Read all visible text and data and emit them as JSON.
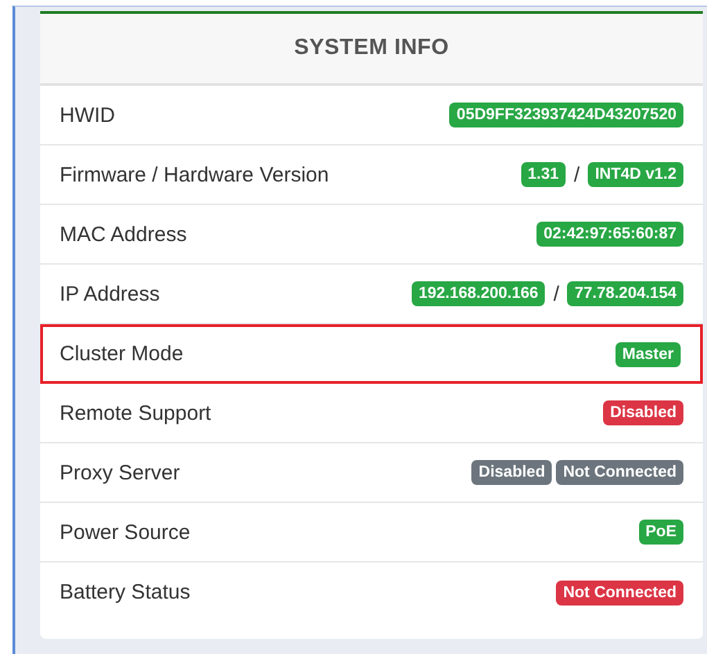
{
  "panel": {
    "title": "SYSTEM INFO"
  },
  "rows": [
    {
      "label": "HWID",
      "highlighted": false,
      "badges": [
        {
          "text": "05D9FF323937424D43207520",
          "color": "#28a745"
        }
      ]
    },
    {
      "label": "Firmware / Hardware Version",
      "highlighted": false,
      "separator": "/",
      "badges": [
        {
          "text": "1.31",
          "color": "#28a745"
        },
        {
          "text": "INT4D v1.2",
          "color": "#28a745"
        }
      ]
    },
    {
      "label": "MAC Address",
      "highlighted": false,
      "badges": [
        {
          "text": "02:42:97:65:60:87",
          "color": "#28a745"
        }
      ]
    },
    {
      "label": "IP Address",
      "highlighted": false,
      "separator": "/",
      "badges": [
        {
          "text": "192.168.200.166",
          "color": "#28a745"
        },
        {
          "text": "77.78.204.154",
          "color": "#28a745"
        }
      ]
    },
    {
      "label": "Cluster Mode",
      "highlighted": true,
      "badges": [
        {
          "text": "Master",
          "color": "#28a745"
        }
      ]
    },
    {
      "label": "Remote Support",
      "highlighted": false,
      "badges": [
        {
          "text": "Disabled",
          "color": "#dc3545"
        }
      ]
    },
    {
      "label": "Proxy Server",
      "highlighted": false,
      "badges": [
        {
          "text": "Disabled",
          "color": "#6c757d"
        },
        {
          "text": "Not Connected",
          "color": "#6c757d"
        }
      ]
    },
    {
      "label": "Power Source",
      "highlighted": false,
      "badges": [
        {
          "text": "PoE",
          "color": "#28a745"
        }
      ]
    },
    {
      "label": "Battery Status",
      "highlighted": false,
      "badges": [
        {
          "text": "Not Connected",
          "color": "#dc3545"
        }
      ]
    }
  ]
}
